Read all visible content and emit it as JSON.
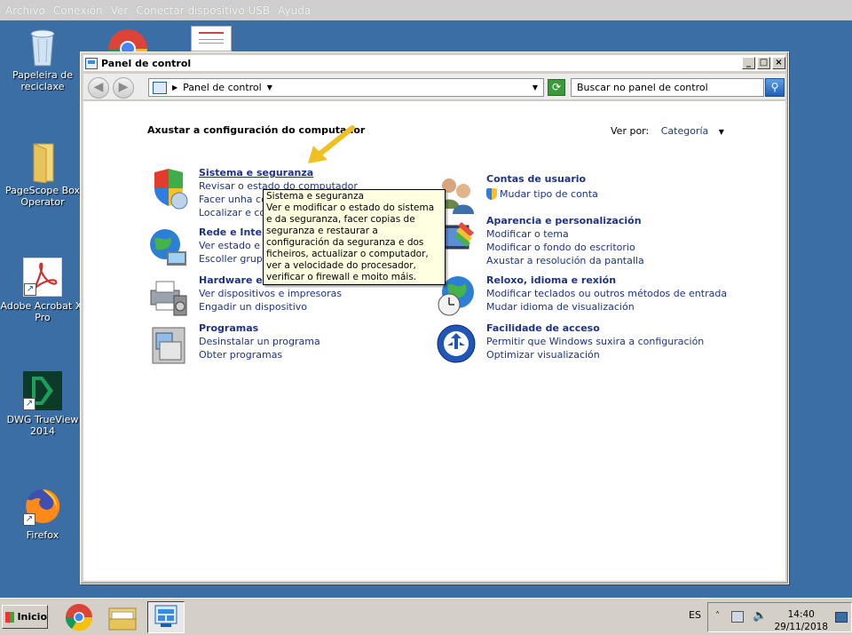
{
  "topbar": {
    "items": [
      "Archivo",
      "Conexión",
      "Ver",
      "Conectar dispositivo USB",
      "Ayuda"
    ]
  },
  "desktop": {
    "icons": [
      {
        "label": "Papeleira de\nreciclaxe",
        "icon": "recycle-bin-icon"
      },
      {
        "label": "PageScope Box\nOperator",
        "icon": "folder-icon"
      },
      {
        "label": "Adobe Acrobat XI\nPro",
        "icon": "acrobat-icon"
      },
      {
        "label": "DWG TrueView\n2014",
        "icon": "dwg-trueview-icon"
      },
      {
        "label": "Firefox",
        "icon": "firefox-icon"
      }
    ]
  },
  "window": {
    "title": "Panel de control",
    "address": "Panel de control",
    "search_placeholder": "Buscar no panel de control",
    "heading": "Axustar a configuración do computador",
    "view_by_label": "Ver por:",
    "view_by_value": "Categoría",
    "categories_left": [
      {
        "title": "Sistema e seguranza",
        "icon": "shield-icon",
        "links": [
          "Revisar o estado do computador",
          "Facer unha co",
          "Localizar e corr"
        ]
      },
      {
        "title": "Rede e Inter",
        "icon": "network-globe-icon",
        "links": [
          "Ver estado e ta",
          "Escoller grupo"
        ]
      },
      {
        "title": "Hardware e son",
        "icon": "printer-icon",
        "links": [
          "Ver dispositivos e impresoras",
          "Engadir un dispositivo"
        ]
      },
      {
        "title": "Programas",
        "icon": "programs-icon",
        "links": [
          "Desinstalar un programa",
          "Obter programas"
        ]
      }
    ],
    "categories_right": [
      {
        "title": "Contas de usuario",
        "icon": "users-icon",
        "links": [
          "Mudar tipo de conta"
        ]
      },
      {
        "title": "Aparencia e personalización",
        "icon": "appearance-icon",
        "links": [
          "Modificar o tema",
          "Modificar o fondo do escritorio",
          "Axustar a resolución da pantalla"
        ]
      },
      {
        "title": "Reloxo, idioma e rexión",
        "icon": "clock-globe-icon",
        "links": [
          "Modificar teclados ou outros métodos de entrada",
          "Mudar idioma de visualización"
        ]
      },
      {
        "title": "Facilidade de acceso",
        "icon": "accessibility-icon",
        "links": [
          "Permitir que Windows suxira a configuración",
          "Optimizar visualización"
        ]
      }
    ],
    "tooltip": {
      "title": "Sistema e seguranza",
      "body": "Ver e modificar o estado do sistema e da seguranza, facer copias de seguranza e restaurar a configuración da seguranza e dos ficheiros, actualizar o computador, ver a velocidade do procesador, verificar o firewall e moito máis."
    }
  },
  "taskbar": {
    "start_label": "Inicio",
    "language": "ES",
    "time": "14:40",
    "date": "29/11/2018"
  },
  "colors": {
    "desktop": "#3a6ea5",
    "link": "#1e3287",
    "tooltip_bg": "#ffffe1",
    "arrow": "#f0c020"
  }
}
